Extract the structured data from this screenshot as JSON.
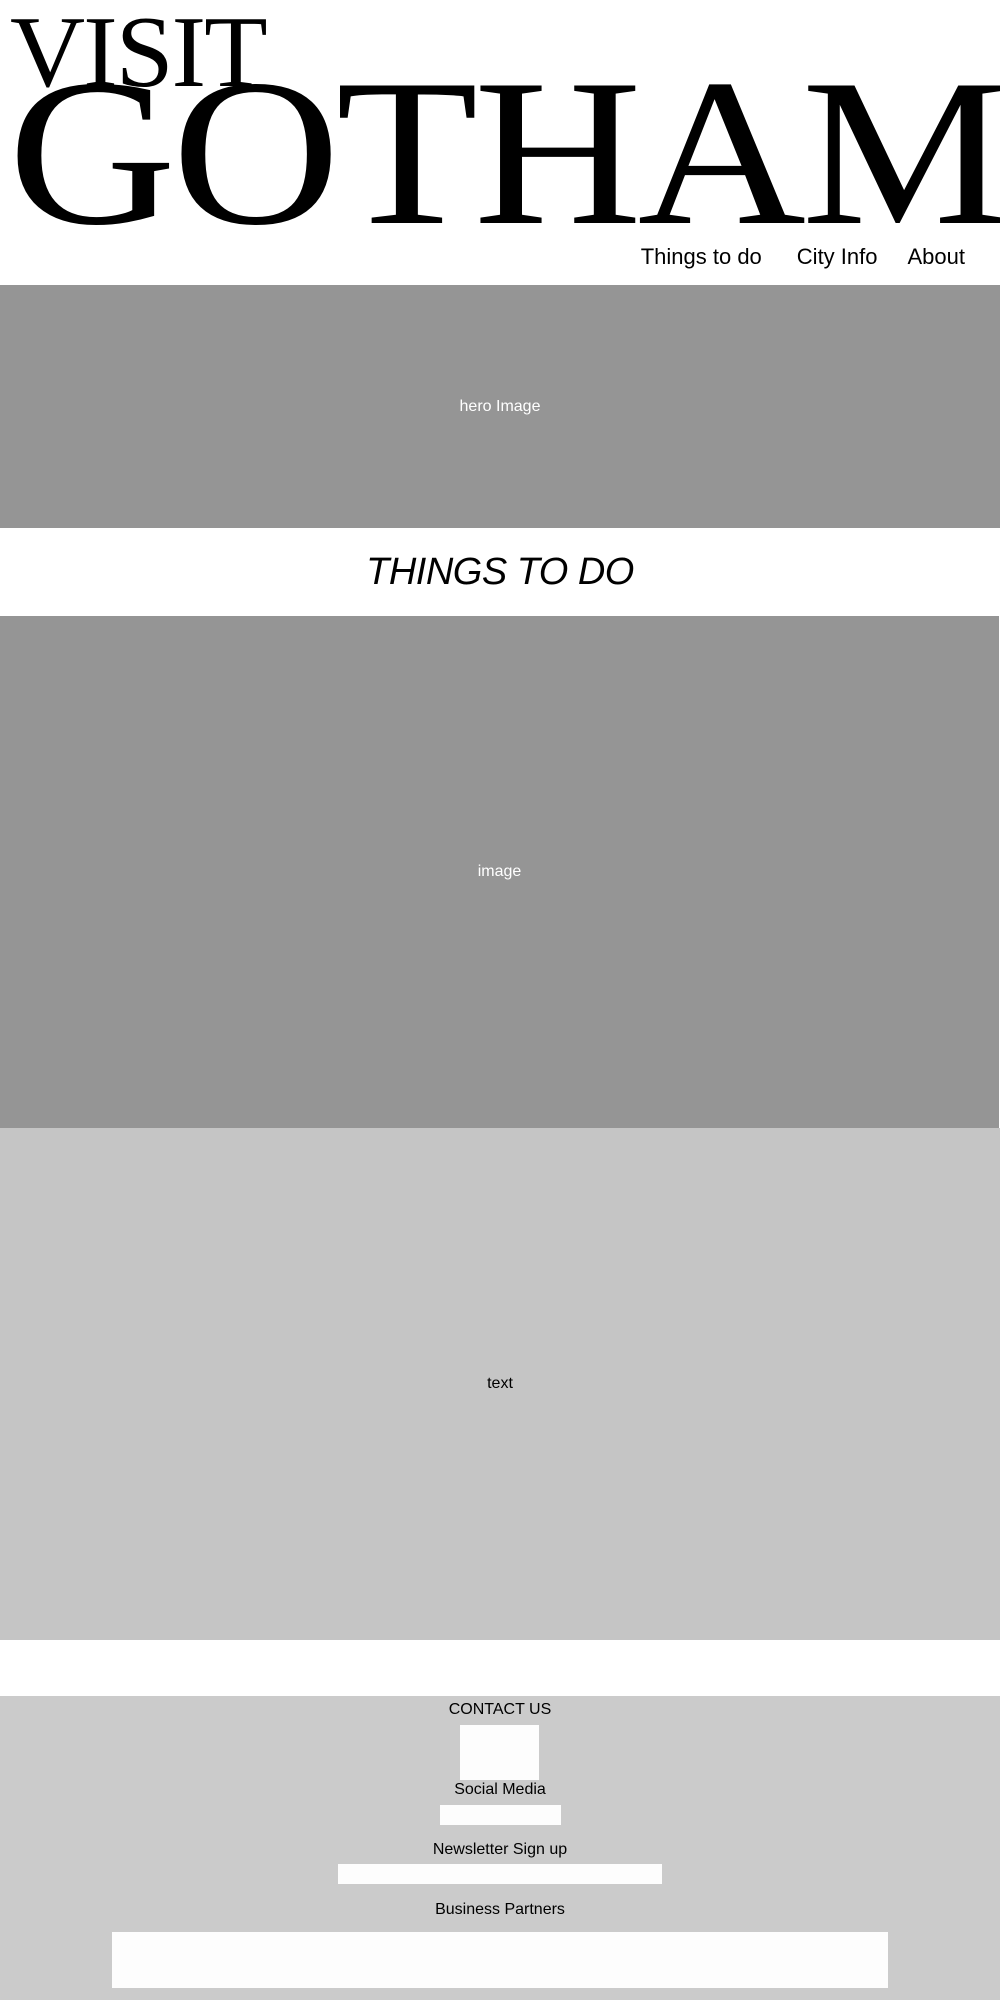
{
  "logo": {
    "line1": "VISIT",
    "line2": "GOTHAM"
  },
  "nav": {
    "items": [
      {
        "label": "Things to do"
      },
      {
        "label": "City Info"
      },
      {
        "label": "About"
      }
    ]
  },
  "hero": {
    "placeholder": "hero Image"
  },
  "things_to_do": {
    "title": "THINGS TO DO",
    "image_placeholder": "image",
    "text_placeholder": "text"
  },
  "footer": {
    "contact_label": "CONTACT US",
    "social_label": "Social Media",
    "newsletter_label": "Newsletter Sign up",
    "partners_label": "Business Partners"
  },
  "colors": {
    "placeholder_dark": "#959595",
    "placeholder_light": "#c5c5c5",
    "footer_bg": "#cbcbcb"
  }
}
